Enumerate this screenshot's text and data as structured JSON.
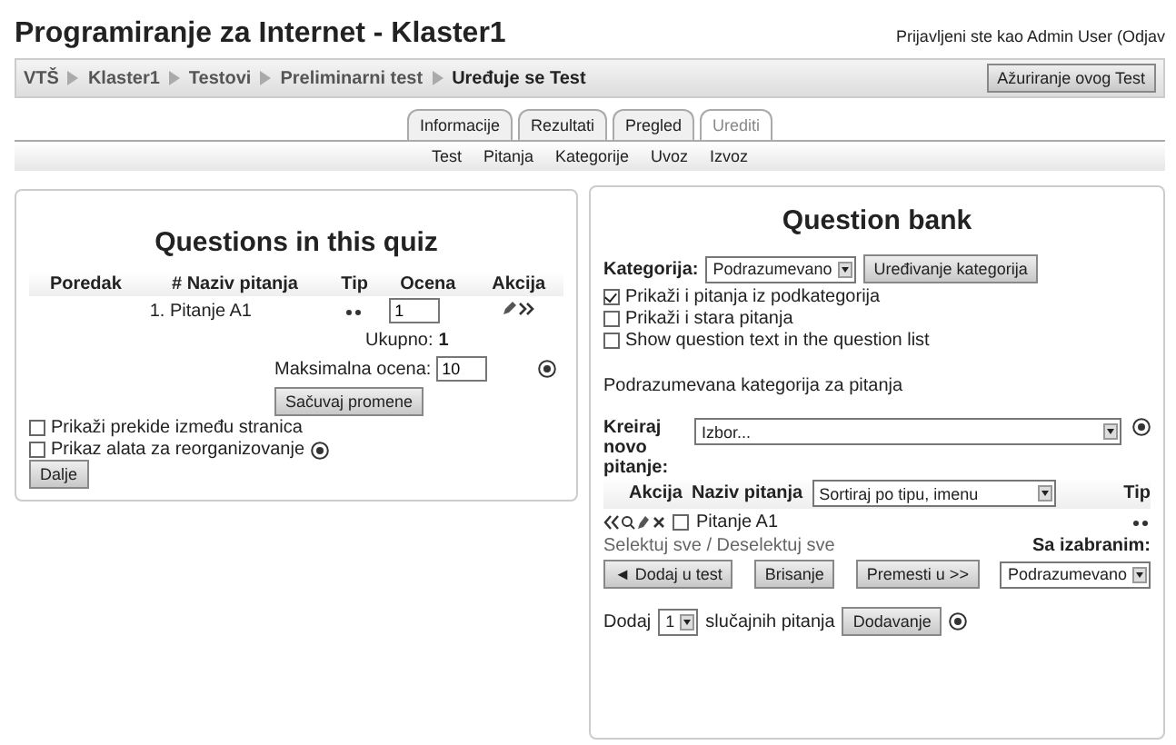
{
  "header": {
    "title": "Programiranje za Internet - Klaster1",
    "login": "Prijavljeni ste kao Admin User (Odjav"
  },
  "breadcrumb": {
    "items": [
      "VTŠ",
      "Klaster1",
      "Testovi",
      "Preliminarni test",
      "Uređuje se Test"
    ],
    "button": "Ažuriranje ovog Test"
  },
  "tabs": [
    {
      "label": "Informacije",
      "selected": false
    },
    {
      "label": "Rezultati",
      "selected": false
    },
    {
      "label": "Pregled",
      "selected": false
    },
    {
      "label": "Urediti",
      "selected": true
    }
  ],
  "subtabs": [
    "Test",
    "Pitanja",
    "Kategorije",
    "Uvoz",
    "Izvoz"
  ],
  "quiz": {
    "title": "Questions in this quiz",
    "columns": [
      "Poredak",
      "# Naziv pitanja",
      "Tip",
      "Ocena",
      "Akcija"
    ],
    "rows": [
      {
        "name": "1. Pitanje A1",
        "grade": "1"
      }
    ],
    "total_label": "Ukupno:",
    "total": "1",
    "max_label": "Maksimalna ocena:",
    "max": "10",
    "save": "Sačuvaj promene",
    "options": [
      {
        "label": "Prikaži prekide između stranica",
        "checked": false,
        "help": false
      },
      {
        "label": "Prikaz alata za reorganizovanje",
        "checked": false,
        "help": true
      }
    ],
    "next": "Dalje"
  },
  "bank": {
    "title": "Question bank",
    "category_label": "Kategorija:",
    "category": "Podrazumevano",
    "edit_categories": "Uređivanje kategorija",
    "options": [
      {
        "label": "Prikaži i pitanja iz podkategorija",
        "checked": true
      },
      {
        "label": "Prikaži i stara pitanja",
        "checked": false
      },
      {
        "label": "Show question text in the question list",
        "checked": false
      }
    ],
    "category_note": "Podrazumevana kategorija za pitanja",
    "create_label": "Kreiraj novo pitanje:",
    "create_value": "Izbor...",
    "columns": [
      "Akcija",
      "Naziv pitanja",
      "Tip"
    ],
    "sort": "Sortiraj po tipu, imenu",
    "rows": [
      {
        "name": "Pitanje A1",
        "checked": false
      }
    ],
    "select_all": "Selektuj sve / Deselektuj sve",
    "with_selected": "Sa izabranim:",
    "actions": [
      "◄ Dodaj u test",
      "Brisanje",
      "Premesti u >>"
    ],
    "move_target": "Podrazumevano",
    "random_prefix": "Dodaj",
    "random_count": "1",
    "random_suffix": "slučajnih pitanja",
    "random_button": "Dodavanje"
  }
}
